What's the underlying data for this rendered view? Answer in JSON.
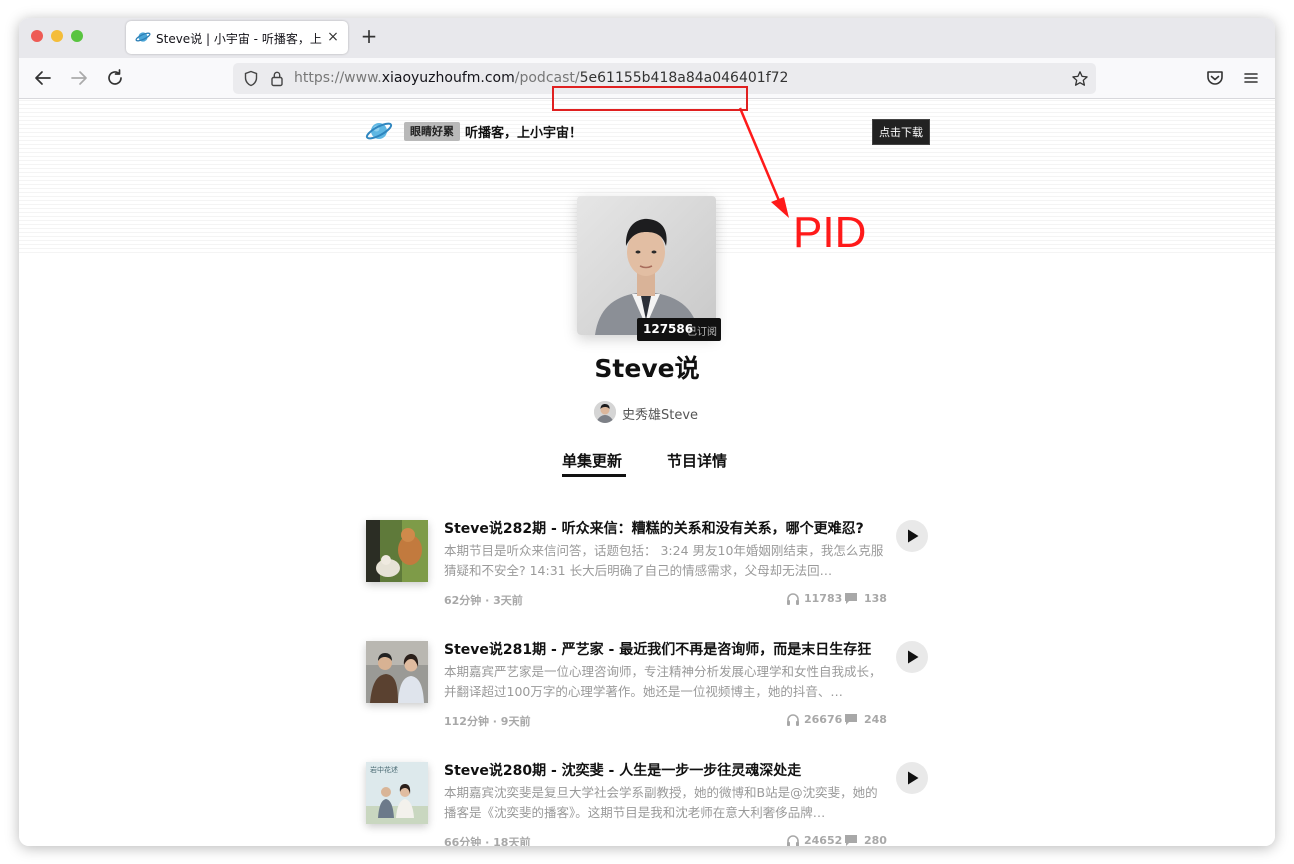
{
  "browser": {
    "tab_title": "Steve说 | 小宇宙 - 听播客，上小宇宙",
    "tab_close": "×",
    "new_tab": "+",
    "url_prefix": "https://www.",
    "url_host": "xiaoyuzhoufm.com",
    "url_path": "/podcast/",
    "url_pid": "5e61155b418a84a046401f72"
  },
  "annotation": {
    "label": "PID",
    "color": "#ff1a1a"
  },
  "banner": {
    "tag": "眼睛好累",
    "slogan": "听播客，上小宇宙！",
    "download_button": "点击下载"
  },
  "podcast": {
    "subscriber_count": "127586",
    "subscriber_label": "已订阅",
    "title": "Steve说",
    "author": "史秀雄Steve"
  },
  "tabs": {
    "episodes": "单集更新",
    "details": "节目详情"
  },
  "episodes": [
    {
      "title": "Steve说282期 - 听众来信：糟糕的关系和没有关系，哪个更难忍?",
      "description": "本期节目是听众来信问答，话题包括： 3:24 男友10年婚姻刚结束，我怎么克服猜疑和不安全? 14:31 长大后明确了自己的情感需求，父母却无法回…",
      "meta": "62分钟 · 3天前",
      "plays": "11783",
      "comments": "138"
    },
    {
      "title": "Steve说281期 - 严艺家 - 最近我们不再是咨询师，而是末日生存狂",
      "description": "本期嘉宾严艺家是一位心理咨询师，专注精神分析发展心理学和女性自我成长，并翻译超过100万字的心理学著作。她还是一位视频博主，她的抖音、…",
      "meta": "112分钟 · 9天前",
      "plays": "26676",
      "comments": "248"
    },
    {
      "title": "Steve说280期 - 沈奕斐 - 人生是一步一步往灵魂深处走",
      "description": "本期嘉宾沈奕斐是复旦大学社会学系副教授，她的微博和B站是@沈奕斐，她的播客是《沈奕斐的播客》。这期节目是我和沈老师在意大利奢侈品牌…",
      "meta": "66分钟 · 18天前",
      "plays": "24652",
      "comments": "280",
      "thumb_caption": "岩中花述"
    }
  ]
}
